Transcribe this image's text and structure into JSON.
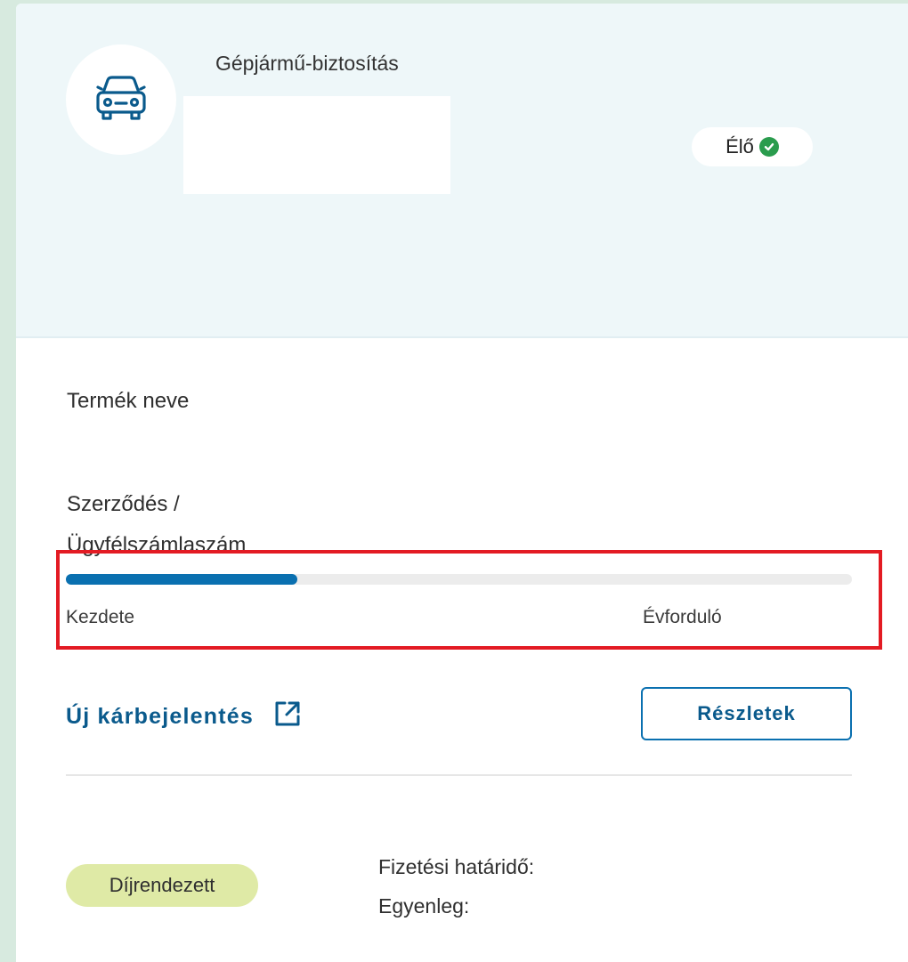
{
  "header": {
    "product_type": "Gépjármű-biztosítás",
    "icon": "car-icon",
    "status": {
      "label": "Élő",
      "icon": "check-circle-icon",
      "color": "#2a9c4d"
    }
  },
  "details": {
    "product_name_label": "Termék neve",
    "contract_label_line1": "Szerződés /",
    "contract_label_line2": "Ügyfélszámlaszám"
  },
  "progress": {
    "value_fraction": 0.295,
    "start_label": "Kezdete",
    "end_label": "Évforduló",
    "fill_color": "#0a70b0"
  },
  "actions": {
    "claim_link_label": "Új kárbejelentés",
    "claim_link_icon": "external-link-icon",
    "details_button_label": "Részletek"
  },
  "payment": {
    "status_badge": "Díjrendezett",
    "due_date_label": "Fizetési határidő:",
    "balance_label": "Egyenleg:"
  }
}
